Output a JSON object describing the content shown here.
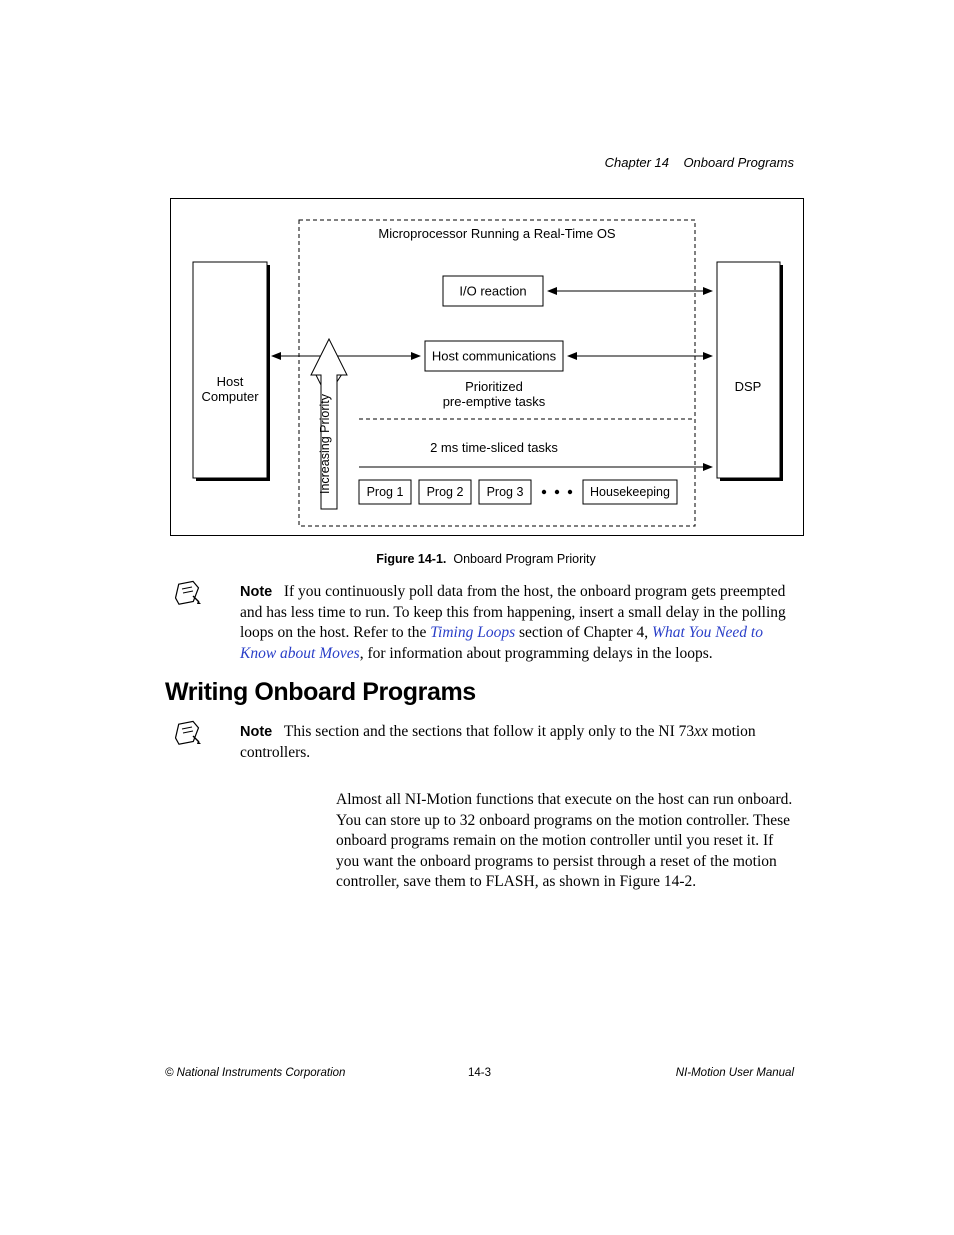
{
  "header": {
    "chapter_label": "Chapter 14",
    "chapter_title": "Onboard Programs"
  },
  "figure": {
    "caption_label": "Figure 14-1.",
    "caption_text": "Onboard Program Priority",
    "os_label": "Microprocessor Running a Real-Time OS",
    "io_reaction": "I/O reaction",
    "host_comm": "Host communications",
    "prioritized_line1": "Prioritized",
    "prioritized_line2": "pre-emptive tasks",
    "sliced_label": "2 ms time-sliced tasks",
    "prog1": "Prog 1",
    "prog2": "Prog 2",
    "prog3": "Prog 3",
    "housekeeping": "Housekeeping",
    "host_computer_line1": "Host",
    "host_computer_line2": "Computer",
    "dsp": "DSP",
    "priority_arrow": "Increasing Priority"
  },
  "note1": {
    "bold": "Note",
    "text_a": "If you continuously poll data from the host, the onboard program gets preempted and has less time to run. To keep this from happening, insert a small delay in the polling loops on the host. Refer to the ",
    "link1": "Timing Loops",
    "text_b": " section of Chapter 4, ",
    "link2": "What You Need to Know about Moves",
    "text_c": ", for information about programming delays in the loops."
  },
  "heading": "Writing Onboard Programs",
  "note2": {
    "bold": "Note",
    "text_a": "This section and the sections that follow it apply only to the NI 73",
    "text_xx": "xx",
    "text_b": " motion controllers."
  },
  "body": {
    "para1": "Almost all NI-Motion functions that execute on the host can run onboard. You can store up to 32 onboard programs on the motion controller. These onboard programs remain on the motion controller until you reset it. If you want the onboard programs to persist through a reset of the motion controller, save them to FLASH, as shown in Figure 14-2."
  },
  "footer": {
    "left": "© National Instruments Corporation",
    "center": "14-3",
    "right": "NI-Motion User Manual"
  }
}
